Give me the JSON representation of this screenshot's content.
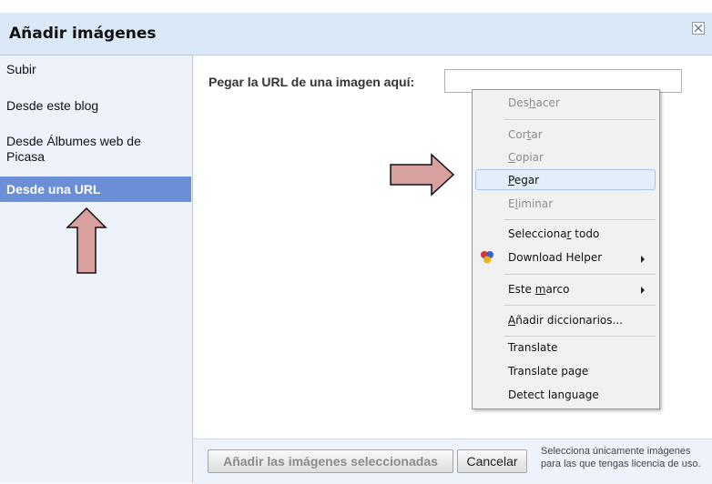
{
  "dialog": {
    "title": "Añadir imágenes"
  },
  "sidebar": {
    "items": [
      {
        "label": "Subir"
      },
      {
        "label": "Desde este blog"
      },
      {
        "label": "Desde Álbumes web de Picasa"
      },
      {
        "label": "Desde una URL",
        "active": true
      }
    ]
  },
  "main": {
    "url_label": "Pegar la URL de una imagen aquí:",
    "url_value": ""
  },
  "footer": {
    "add_label": "Añadir las imágenes seleccionadas",
    "cancel_label": "Cancelar",
    "note": "Selecciona únicamente imágenes para las que tengas licencia de uso."
  },
  "context_menu": {
    "items": [
      {
        "label": "Deshacer",
        "mnemonic": "h",
        "disabled": true
      },
      {
        "label": "Cortar",
        "mnemonic": "t",
        "disabled": true
      },
      {
        "label": "Copiar",
        "mnemonic": "C",
        "disabled": true
      },
      {
        "label": "Pegar",
        "mnemonic": "P",
        "highlighted": true
      },
      {
        "label": "Eliminar",
        "mnemonic": "l",
        "disabled": true
      },
      {
        "label": "Seleccionar todo",
        "mnemonic": "r"
      },
      {
        "label": "Download Helper",
        "submenu": true,
        "icon": "download-helper-icon"
      },
      {
        "label": "Este marco",
        "mnemonic": "m",
        "submenu": true
      },
      {
        "label": "Añadir diccionarios...",
        "mnemonic": "A"
      },
      {
        "label": "Translate"
      },
      {
        "label": "Translate page"
      },
      {
        "label": "Detect language"
      }
    ]
  },
  "colors": {
    "header_bg": "#dbe8f8",
    "sidebar_bg": "#eef3fb",
    "active_item": "#6a8fd6",
    "arrow_fill": "#d9a0a0"
  }
}
